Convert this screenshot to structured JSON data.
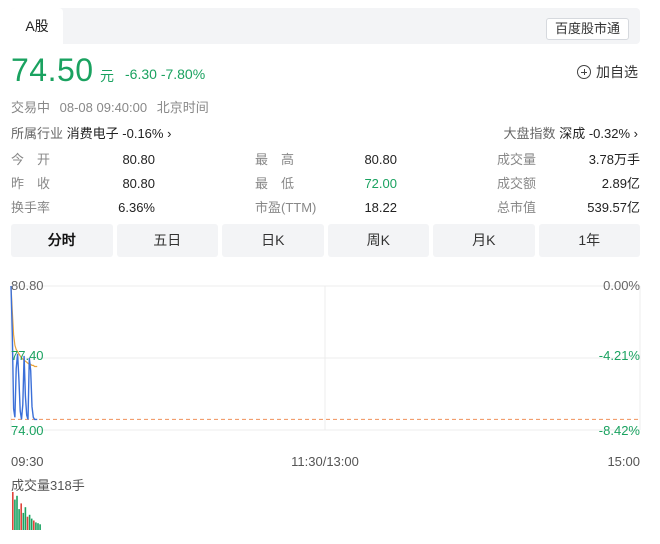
{
  "header": {
    "tab_label": "A股",
    "platform_tag": "百度股市通"
  },
  "quote": {
    "price": "74.50",
    "unit": "元",
    "change": "-6.30",
    "change_pct": "-7.80%",
    "add_watchlist_label": "加自选",
    "status": "交易中",
    "datetime": "08-08 09:40:00",
    "timezone": "北京时间"
  },
  "industry": {
    "label": "所属行业",
    "name": "消费电子",
    "change": "-0.16%"
  },
  "index": {
    "label": "大盘指数",
    "name": "深成",
    "change": "-0.32%"
  },
  "stats": {
    "open_label": "今　开",
    "open": "80.80",
    "high_label": "最　高",
    "high": "80.80",
    "volume_label": "成交量",
    "volume": "3.78万手",
    "prev_close_label": "昨　收",
    "prev_close": "80.80",
    "low_label": "最　低",
    "low": "72.00",
    "turnover_label": "成交额",
    "turnover": "2.89亿",
    "turnover_rate_label": "换手率",
    "turnover_rate": "6.36%",
    "pe_label": "市盈(TTM)",
    "pe": "18.22",
    "market_cap_label": "总市值",
    "market_cap": "539.57亿"
  },
  "periods": [
    "分时",
    "五日",
    "日K",
    "周K",
    "月K",
    "1年"
  ],
  "active_period": "分时",
  "colors": {
    "down_green": "#1aa260",
    "price_line": "#3b6fd8",
    "avg_line": "#e8a33c",
    "ref_line": "#f0915a"
  },
  "chart_data": {
    "type": "line",
    "title": "",
    "x_ticks": [
      "09:30",
      "11:30/13:00",
      "15:00"
    ],
    "y_ticks_left": [
      "80.80",
      "77.40",
      "74.00"
    ],
    "y_ticks_right": [
      "0.00%",
      "-4.21%",
      "-8.42%"
    ],
    "ylim": [
      74.0,
      80.8
    ],
    "prev_close": 80.8,
    "volume_label": "成交量318手",
    "series": [
      {
        "name": "",
        "minutes": [
          0,
          0.5,
          1,
          1.5,
          2,
          2.5,
          3,
          3.5,
          4,
          4.5,
          5,
          5.5,
          6,
          6.5,
          7,
          7.5,
          8,
          8.5,
          9,
          9.5,
          10
        ],
        "values": [
          80.8,
          78.6,
          75.0,
          74.6,
          76.9,
          77.6,
          76.4,
          74.9,
          74.5,
          75.2,
          77.5,
          75.6,
          74.7,
          74.5,
          77.4,
          76.8,
          75.1,
          74.6,
          74.5,
          74.5,
          74.5
        ]
      },
      {
        "name": "",
        "minutes": [
          0,
          0.5,
          1,
          1.5,
          2,
          2.5,
          3,
          3.5,
          4,
          4.5,
          5,
          5.5,
          6,
          6.5,
          7,
          7.5,
          8,
          8.5,
          9,
          9.5,
          10
        ],
        "values": [
          80.8,
          79.6,
          78.5,
          78.0,
          77.8,
          77.7,
          77.6,
          77.5,
          77.4,
          77.35,
          77.3,
          77.25,
          77.2,
          77.15,
          77.1,
          77.1,
          77.05,
          77.05,
          77.0,
          77.0,
          77.0
        ]
      }
    ],
    "volume_bars": [
      {
        "v": 1.0,
        "c": "red"
      },
      {
        "v": 0.8,
        "c": "green"
      },
      {
        "v": 0.9,
        "c": "green"
      },
      {
        "v": 0.55,
        "c": "green"
      },
      {
        "v": 0.7,
        "c": "red"
      },
      {
        "v": 0.45,
        "c": "green"
      },
      {
        "v": 0.6,
        "c": "green"
      },
      {
        "v": 0.35,
        "c": "red"
      },
      {
        "v": 0.4,
        "c": "green"
      },
      {
        "v": 0.3,
        "c": "green"
      },
      {
        "v": 0.25,
        "c": "red"
      },
      {
        "v": 0.2,
        "c": "green"
      },
      {
        "v": 0.18,
        "c": "green"
      },
      {
        "v": 0.15,
        "c": "green"
      }
    ]
  }
}
